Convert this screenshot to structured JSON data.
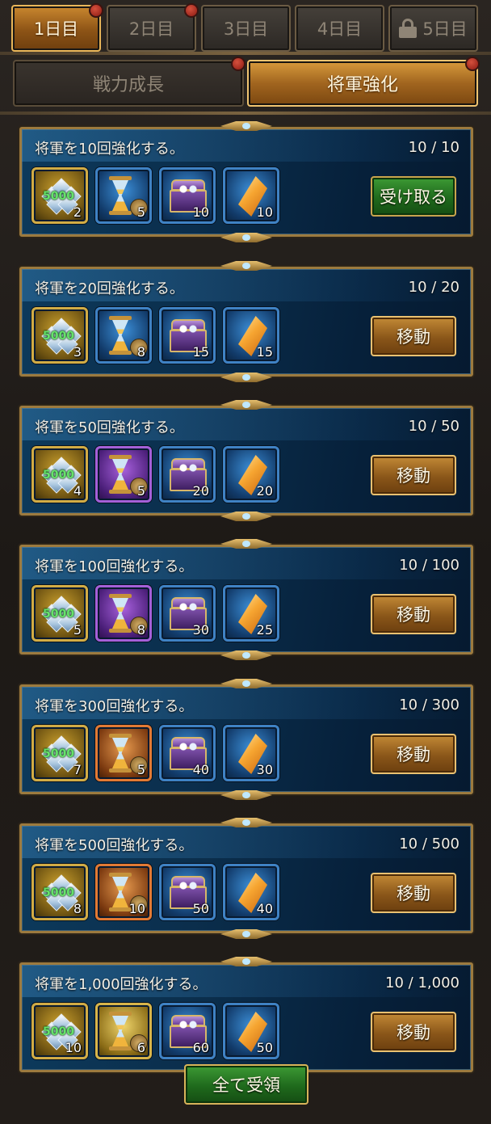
{
  "day_tabs": [
    {
      "label": "1日目",
      "active": true,
      "badge": true,
      "locked": false
    },
    {
      "label": "2日目",
      "active": false,
      "badge": true,
      "locked": false
    },
    {
      "label": "3日目",
      "active": false,
      "badge": false,
      "locked": false
    },
    {
      "label": "4日目",
      "active": false,
      "badge": false,
      "locked": false
    },
    {
      "label": "5日目",
      "active": false,
      "badge": false,
      "locked": true
    }
  ],
  "category_tabs": [
    {
      "label": "戦力成長",
      "active": false,
      "badge": true
    },
    {
      "label": "将軍強化",
      "active": true,
      "badge": true
    }
  ],
  "gem_label": "5000",
  "tasks": [
    {
      "title": "将軍を10回強化する。",
      "progress": "10 / 10",
      "button": "受け取る",
      "button_type": "claim",
      "rewards": [
        {
          "type": "gems",
          "qty": "2"
        },
        {
          "type": "hourglass",
          "rarity": "blue",
          "qty": "5"
        },
        {
          "type": "chest",
          "qty": "10"
        },
        {
          "type": "crystal",
          "qty": "10"
        }
      ]
    },
    {
      "title": "将軍を20回強化する。",
      "progress": "10 / 20",
      "button": "移動",
      "button_type": "go",
      "rewards": [
        {
          "type": "gems",
          "qty": "3"
        },
        {
          "type": "hourglass",
          "rarity": "blue",
          "qty": "8"
        },
        {
          "type": "chest",
          "qty": "15"
        },
        {
          "type": "crystal",
          "qty": "15"
        }
      ]
    },
    {
      "title": "将軍を50回強化する。",
      "progress": "10 / 50",
      "button": "移動",
      "button_type": "go",
      "rewards": [
        {
          "type": "gems",
          "qty": "4"
        },
        {
          "type": "hourglass",
          "rarity": "purple",
          "qty": "5"
        },
        {
          "type": "chest",
          "qty": "20"
        },
        {
          "type": "crystal",
          "qty": "20"
        }
      ]
    },
    {
      "title": "将軍を100回強化する。",
      "progress": "10 / 100",
      "button": "移動",
      "button_type": "go",
      "rewards": [
        {
          "type": "gems",
          "qty": "5"
        },
        {
          "type": "hourglass",
          "rarity": "purple",
          "qty": "8"
        },
        {
          "type": "chest",
          "qty": "30"
        },
        {
          "type": "crystal",
          "qty": "25"
        }
      ]
    },
    {
      "title": "将軍を300回強化する。",
      "progress": "10 / 300",
      "button": "移動",
      "button_type": "go",
      "rewards": [
        {
          "type": "gems",
          "qty": "7"
        },
        {
          "type": "hourglass",
          "rarity": "orange",
          "qty": "5"
        },
        {
          "type": "chest",
          "qty": "40"
        },
        {
          "type": "crystal",
          "qty": "30"
        }
      ]
    },
    {
      "title": "将軍を500回強化する。",
      "progress": "10 / 500",
      "button": "移動",
      "button_type": "go",
      "rewards": [
        {
          "type": "gems",
          "qty": "8"
        },
        {
          "type": "hourglass",
          "rarity": "orange",
          "qty": "10"
        },
        {
          "type": "chest",
          "qty": "50"
        },
        {
          "type": "crystal",
          "qty": "40"
        }
      ]
    },
    {
      "title": "将軍を1,000回強化する。",
      "progress": "10 / 1,000",
      "button": "移動",
      "button_type": "go",
      "rewards": [
        {
          "type": "gems",
          "qty": "10"
        },
        {
          "type": "hourglass",
          "rarity": "yellow",
          "qty": "6"
        },
        {
          "type": "chest",
          "qty": "60"
        },
        {
          "type": "crystal",
          "qty": "50"
        }
      ]
    }
  ],
  "claim_all_label": "全て受領"
}
